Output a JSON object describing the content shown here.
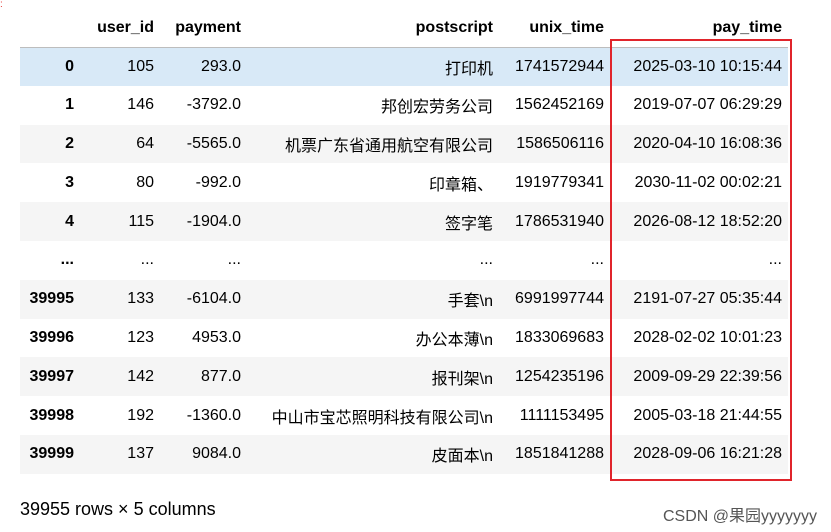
{
  "table": {
    "columns": [
      "user_id",
      "payment",
      "postscript",
      "unix_time",
      "pay_time"
    ],
    "rows": [
      {
        "index": "0",
        "cells": [
          "105",
          "293.0",
          "打印机",
          "1741572944",
          "2025-03-10 10:15:44"
        ]
      },
      {
        "index": "1",
        "cells": [
          "146",
          "-3792.0",
          "邦创宏劳务公司",
          "1562452169",
          "2019-07-07 06:29:29"
        ]
      },
      {
        "index": "2",
        "cells": [
          "64",
          "-5565.0",
          "机票广东省通用航空有限公司",
          "1586506116",
          "2020-04-10 16:08:36"
        ]
      },
      {
        "index": "3",
        "cells": [
          "80",
          "-992.0",
          "印章箱、",
          "1919779341",
          "2030-11-02 00:02:21"
        ]
      },
      {
        "index": "4",
        "cells": [
          "115",
          "-1904.0",
          "签字笔",
          "1786531940",
          "2026-08-12 18:52:20"
        ]
      },
      {
        "index": "...",
        "cells": [
          "...",
          "...",
          "...",
          "...",
          "..."
        ]
      },
      {
        "index": "39995",
        "cells": [
          "133",
          "-6104.0",
          "手套\\n",
          "6991997744",
          "2191-07-27 05:35:44"
        ]
      },
      {
        "index": "39996",
        "cells": [
          "123",
          "4953.0",
          "办公本薄\\n",
          "1833069683",
          "2028-02-02 10:01:23"
        ]
      },
      {
        "index": "39997",
        "cells": [
          "142",
          "877.0",
          "报刊架\\n",
          "1254235196",
          "2009-09-29 22:39:56"
        ]
      },
      {
        "index": "39998",
        "cells": [
          "192",
          "-1360.0",
          "中山市宝芯照明科技有限公司\\n",
          "1111153495",
          "2005-03-18 21:44:55"
        ]
      },
      {
        "index": "39999",
        "cells": [
          "137",
          "9084.0",
          "皮面本\\n",
          "1851841288",
          "2028-09-06 16:21:28"
        ]
      }
    ]
  },
  "shape_info": "39955 rows × 5 columns",
  "watermark": "CSDN @果园yyyyyyy",
  "colors": {
    "highlight_row": "#d8e9f7",
    "annotation_box": "#e0242b"
  }
}
